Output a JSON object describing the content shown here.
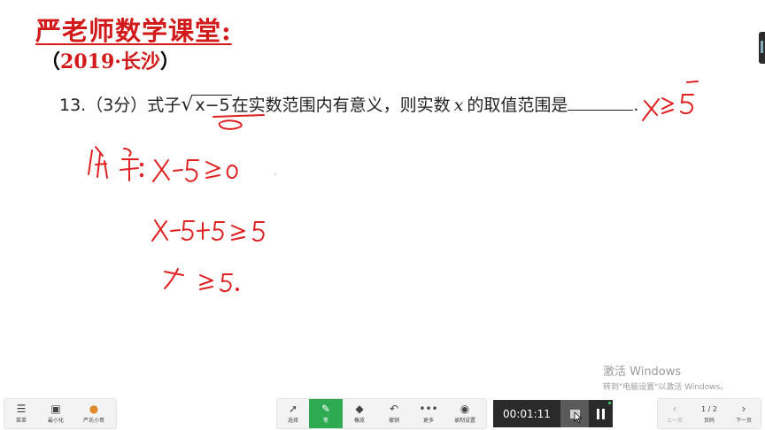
{
  "board": {
    "title": "严老师数学课堂:",
    "subtitle_open": "（",
    "subtitle_year": "2019·长沙",
    "subtitle_close": "）",
    "problem_prefix": "13.（3分）式子",
    "radicand": "x−5",
    "problem_middle": "在实数范围内有意义，则实数",
    "problem_var": "x",
    "problem_suffix": "的取值范围是",
    "problem_end": ".",
    "handwriting": {
      "answer_blank": "x≥5",
      "line1": "解：x-5≥0",
      "line2": "x-5+5≥5",
      "line3": "x≥5."
    }
  },
  "watermark": {
    "line1": "激活 Windows",
    "line2": "转到\"电脑设置\"以激活 Windows。"
  },
  "toolbar": {
    "left": [
      {
        "icon": "menu-icon",
        "label": "菜单"
      },
      {
        "icon": "minimize-icon",
        "label": "最小化"
      },
      {
        "icon": "avatar-icon",
        "label": "严氏小哥"
      }
    ],
    "tools": [
      {
        "icon": "select-icon",
        "label": "选择"
      },
      {
        "icon": "pen-icon",
        "label": "笔",
        "active": true
      },
      {
        "icon": "eraser-icon",
        "label": "橡皮"
      },
      {
        "icon": "undo-icon",
        "label": "撤销"
      },
      {
        "icon": "more-icon",
        "label": "更多"
      },
      {
        "icon": "record-settings-icon",
        "label": "录制设置"
      }
    ],
    "timer": "00:01:11",
    "pager": {
      "prev_label": "上一页",
      "page": "1 / 2",
      "page_label": "页码",
      "next_label": "下一页"
    }
  },
  "colors": {
    "ink": "#e02020",
    "title": "#d21a1a",
    "active_tool": "#2eaa53"
  }
}
